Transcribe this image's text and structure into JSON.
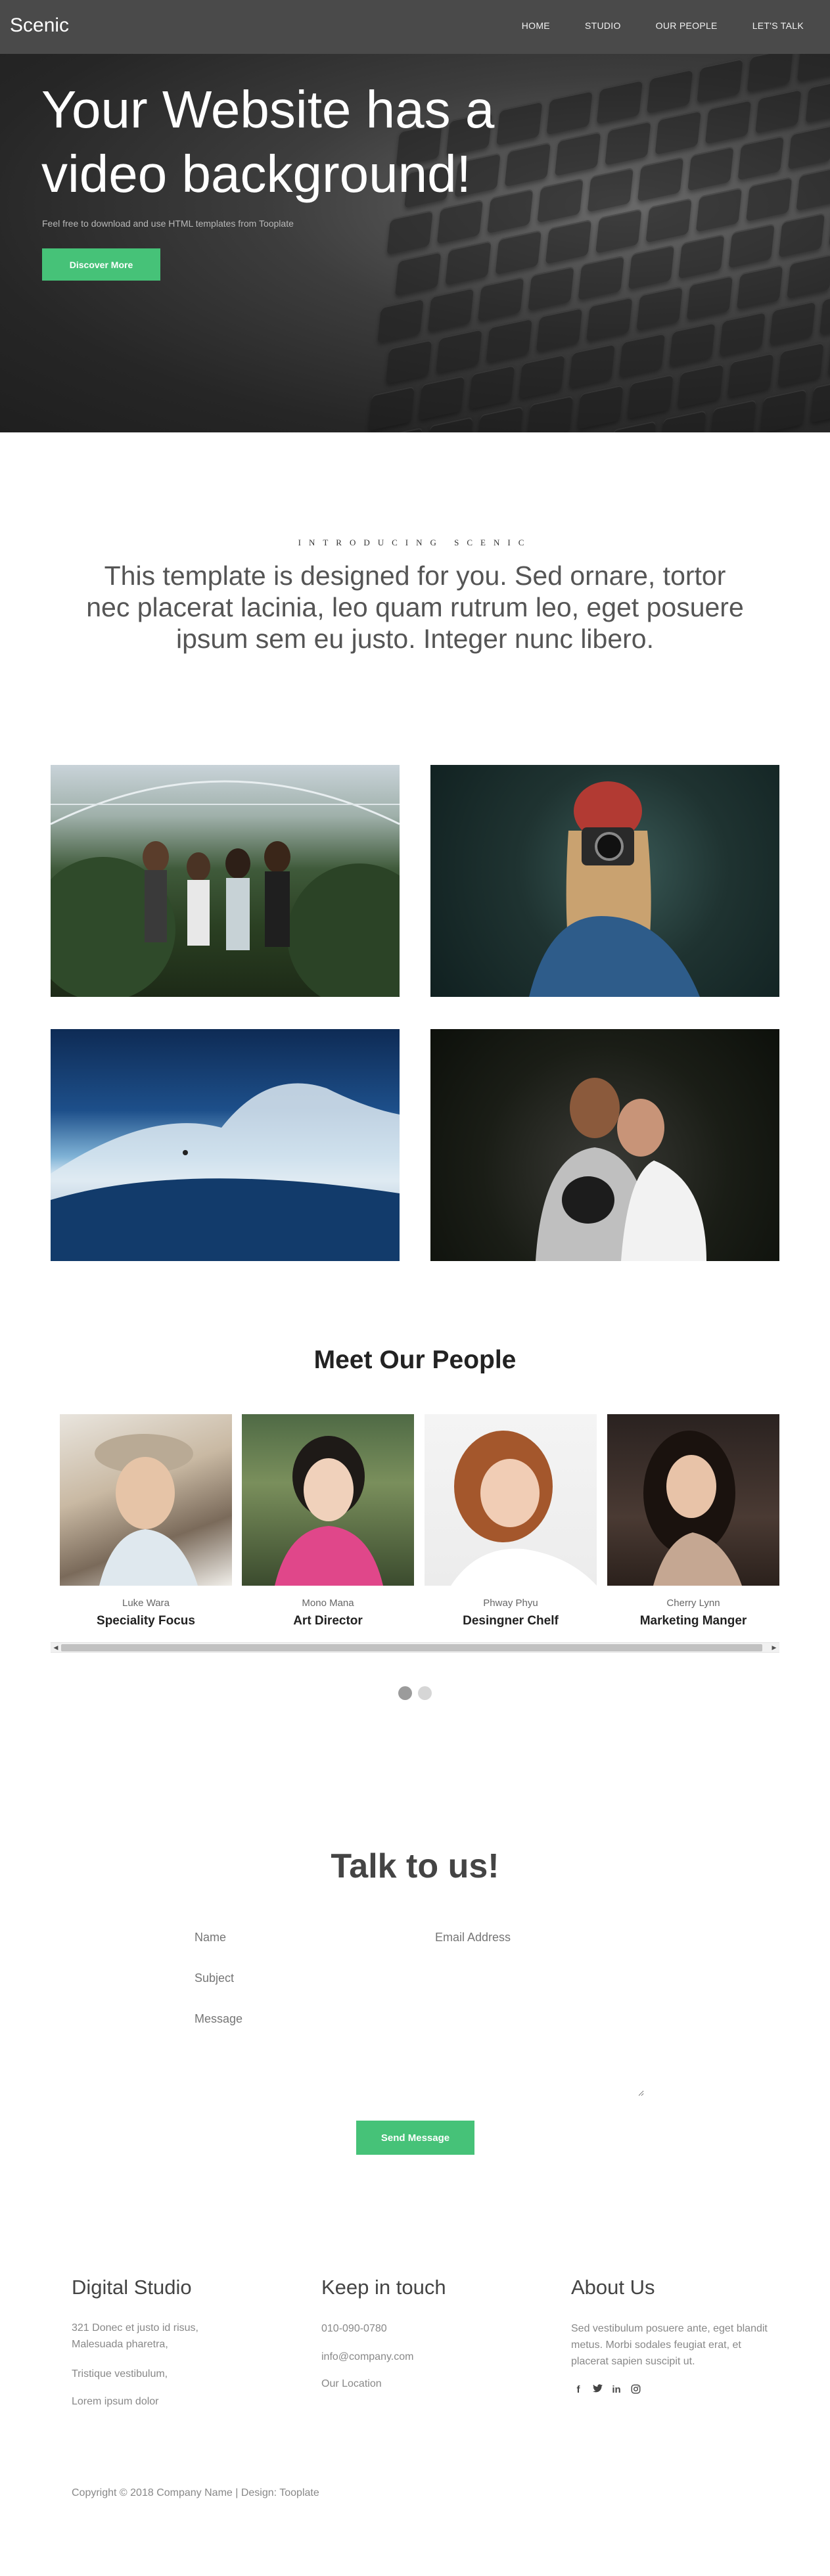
{
  "nav": {
    "brand": "Scenic",
    "links": [
      "HOME",
      "STUDIO",
      "OUR PEOPLE",
      "LET'S TALK"
    ]
  },
  "hero": {
    "title": "Your Website has a video background!",
    "subtitle": "Feel free to download and use HTML templates from Tooplate",
    "button": "Discover More"
  },
  "intro": {
    "kicker": "INTRODUCING SCENIC",
    "text": "This template is designed for you. Sed ornare, tortor nec placerat lacinia, leo quam rutrum leo, eget posuere ipsum sem eu justo. Integer nunc libero."
  },
  "people": {
    "title": "Meet Our People",
    "members": [
      {
        "name": "Luke Wara",
        "role": "Speciality Focus"
      },
      {
        "name": "Mono Mana",
        "role": "Art Director"
      },
      {
        "name": "Phway Phyu",
        "role": "Desingner Chelf"
      },
      {
        "name": "Cherry Lynn",
        "role": "Marketing Manger"
      }
    ],
    "carousel_page": 1,
    "carousel_pages": 2
  },
  "contact": {
    "title": "Talk to us!",
    "name_placeholder": "Name",
    "email_placeholder": "Email Address",
    "subject_placeholder": "Subject",
    "message_placeholder": "Message",
    "button": "Send Message"
  },
  "footer": {
    "col1": {
      "title": "Digital Studio",
      "address": "321 Donec et justo id risus, Malesuada pharetra,",
      "line2": "Tristique vestibulum,",
      "line3": "Lorem ipsum dolor"
    },
    "col2": {
      "title": "Keep in touch",
      "phone": "010-090-0780",
      "email": "info@company.com",
      "location": "Our Location"
    },
    "col3": {
      "title": "About Us",
      "text": "Sed vestibulum posuere ante, eget blandit metus. Morbi sodales feugiat erat, et placerat sapien suscipit ut.",
      "social": [
        "facebook-icon",
        "twitter-icon",
        "linkedin-icon",
        "instagram-icon"
      ]
    },
    "copyright": "Copyright © 2018 Company Name | Design: Tooplate"
  },
  "colors": {
    "accent": "#46c278",
    "nav_bg": "#4a4a4a"
  }
}
